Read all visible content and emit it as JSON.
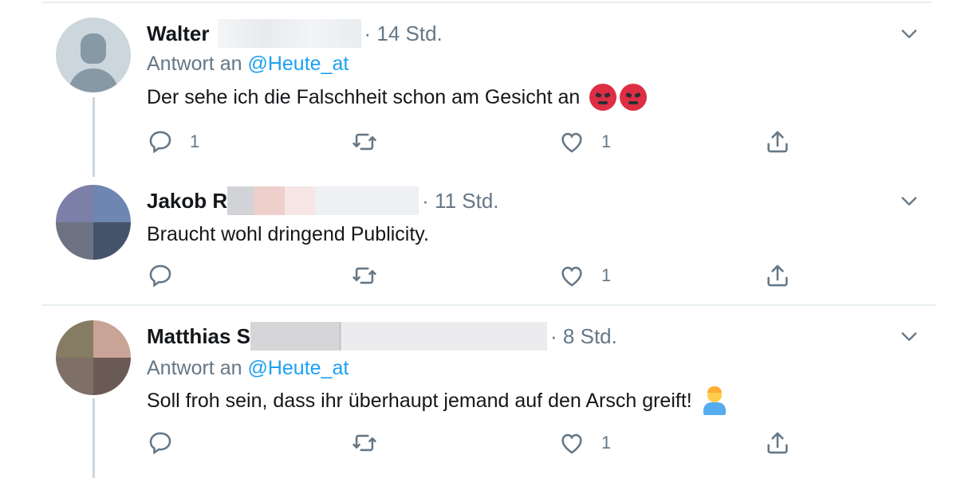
{
  "tweets": [
    {
      "name": "Walter",
      "time": "· 14 Std.",
      "reply_prefix": "Antwort an ",
      "reply_handle": "@Heute_at",
      "text": "Der sehe ich die Falschheit schon am Gesicht an",
      "emoji": "angry-face-emoji x2",
      "reply_count": "1",
      "retweet_count": "",
      "like_count": "1"
    },
    {
      "name": "Jakob R",
      "time": "· 11 Std.",
      "text": "Braucht wohl dringend Publicity.",
      "reply_count": "",
      "retweet_count": "",
      "like_count": "1"
    },
    {
      "name": "Matthias S",
      "time": "· 8 Std.",
      "reply_prefix": "Antwort an ",
      "reply_handle": "@Heute_at",
      "text": "Soll froh sein, dass ihr überhaupt jemand auf den Arsch greift!",
      "emoji": "farmer-emoji",
      "reply_count": "",
      "retweet_count": "",
      "like_count": "1"
    }
  ],
  "icons": [
    "reply-icon",
    "retweet-icon",
    "like-icon",
    "share-icon",
    "chevron-down-icon"
  ],
  "colors": {
    "text": "#14171a",
    "secondary": "#657786",
    "mention": "#1da1f2",
    "divider": "#e6ecf0",
    "thread_line": "#ccd6dd"
  }
}
